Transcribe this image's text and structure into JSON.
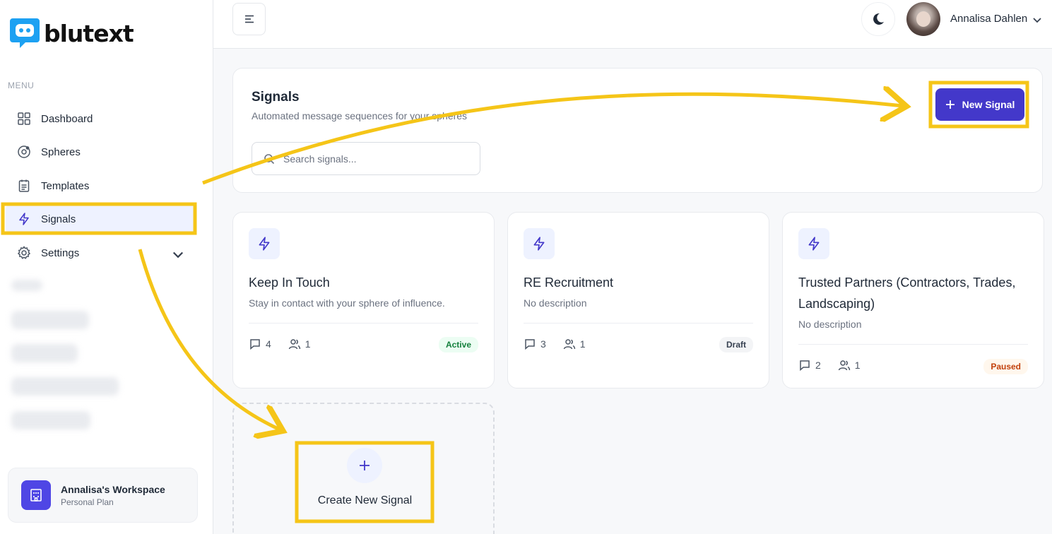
{
  "brand": {
    "name": "blutext",
    "accent": "#4338ca",
    "logo_color": "#1da1f2"
  },
  "sidebar": {
    "menu_label": "MENU",
    "items": [
      {
        "label": "Dashboard",
        "icon": "grid-icon"
      },
      {
        "label": "Spheres",
        "icon": "sphere-icon"
      },
      {
        "label": "Templates",
        "icon": "clipboard-icon"
      },
      {
        "label": "Signals",
        "icon": "lightning-icon",
        "active": true
      },
      {
        "label": "Settings",
        "icon": "gear-icon"
      }
    ],
    "workspace": {
      "name": "Annalisa's Workspace",
      "plan": "Personal Plan"
    }
  },
  "topbar": {
    "user_name": "Annalisa Dahlen"
  },
  "header": {
    "title": "Signals",
    "subtitle": "Automated message sequences for your spheres",
    "search_placeholder": "Search signals...",
    "new_button": "New Signal"
  },
  "signals": [
    {
      "title": "Keep In Touch",
      "description": "Stay in contact with your sphere of influence.",
      "messages": "4",
      "members": "1",
      "status": "Active"
    },
    {
      "title": "RE Recruitment",
      "description": "No description",
      "messages": "3",
      "members": "1",
      "status": "Draft"
    },
    {
      "title": "Trusted Partners (Contractors, Trades, Landscaping)",
      "description": "No description",
      "messages": "2",
      "members": "1",
      "status": "Paused"
    }
  ],
  "create_card": {
    "label": "Create New Signal"
  },
  "annotation_color": "#f5c518"
}
